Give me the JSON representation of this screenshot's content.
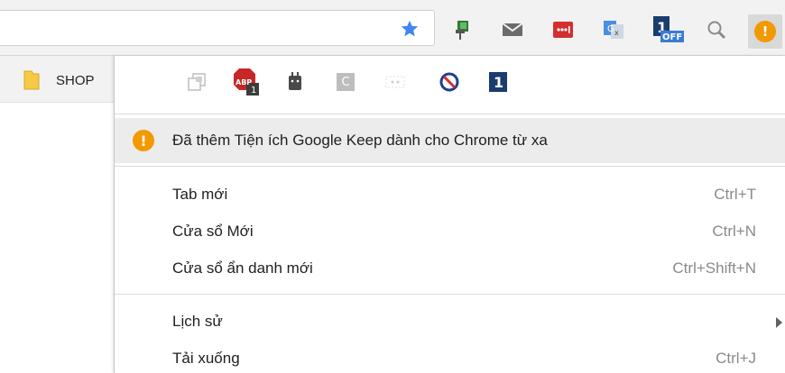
{
  "toolbar": {
    "active_extension_icon": "warning-circle-icon",
    "extension_icons": [
      "push-pin-extension-icon",
      "mail-envelope-icon",
      "lastpass-icon",
      "google-translate-icon",
      "one-off-icon",
      "magnifier-icon"
    ],
    "one_off_badge": "OFF",
    "star_color": "#4285f4"
  },
  "bookmarks": {
    "folder_label": "SHOP"
  },
  "menu": {
    "extensions_row": [
      {
        "icon": "window-pin-icon"
      },
      {
        "icon": "adblock-plus-icon",
        "badge": "1",
        "label": "ABP"
      },
      {
        "icon": "plug-icon"
      },
      {
        "icon": "c-box-icon",
        "label": "C"
      },
      {
        "icon": "dotted-box-icon"
      },
      {
        "icon": "block-icon"
      },
      {
        "icon": "one-extension-icon"
      }
    ],
    "notice": {
      "icon_glyph": "!",
      "text": "Đã thêm Tiện ích Google Keep dành cho Chrome từ xa",
      "color": "#f29900"
    },
    "items": [
      {
        "label": "Tab mới",
        "shortcut": "Ctrl+T"
      },
      {
        "label": "Cửa sổ Mới",
        "shortcut": "Ctrl+N"
      },
      {
        "label": "Cửa sổ ẩn danh mới",
        "shortcut": "Ctrl+Shift+N"
      },
      {
        "label": "Lịch sử",
        "shortcut": ""
      },
      {
        "label": "Tải xuống",
        "shortcut": "Ctrl+J"
      }
    ]
  }
}
